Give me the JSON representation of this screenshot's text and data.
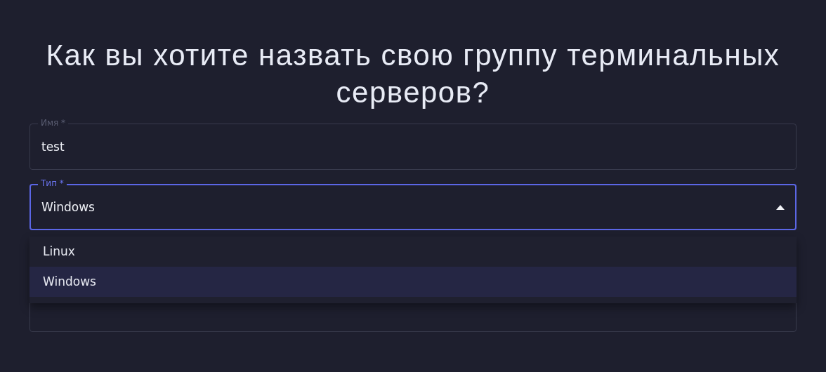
{
  "title": "Как вы хотите назвать свою группу терминальных серверов?",
  "fields": [
    {
      "label": "Имя *",
      "value": "test",
      "kind": "text",
      "focused": false
    },
    {
      "label": "Тип *",
      "value": "Windows",
      "kind": "select",
      "focused": true,
      "expanded": true,
      "options": [
        {
          "label": "Linux",
          "selected": false
        },
        {
          "label": "Windows",
          "selected": true
        }
      ]
    },
    {
      "kind": "multiline"
    }
  ]
}
